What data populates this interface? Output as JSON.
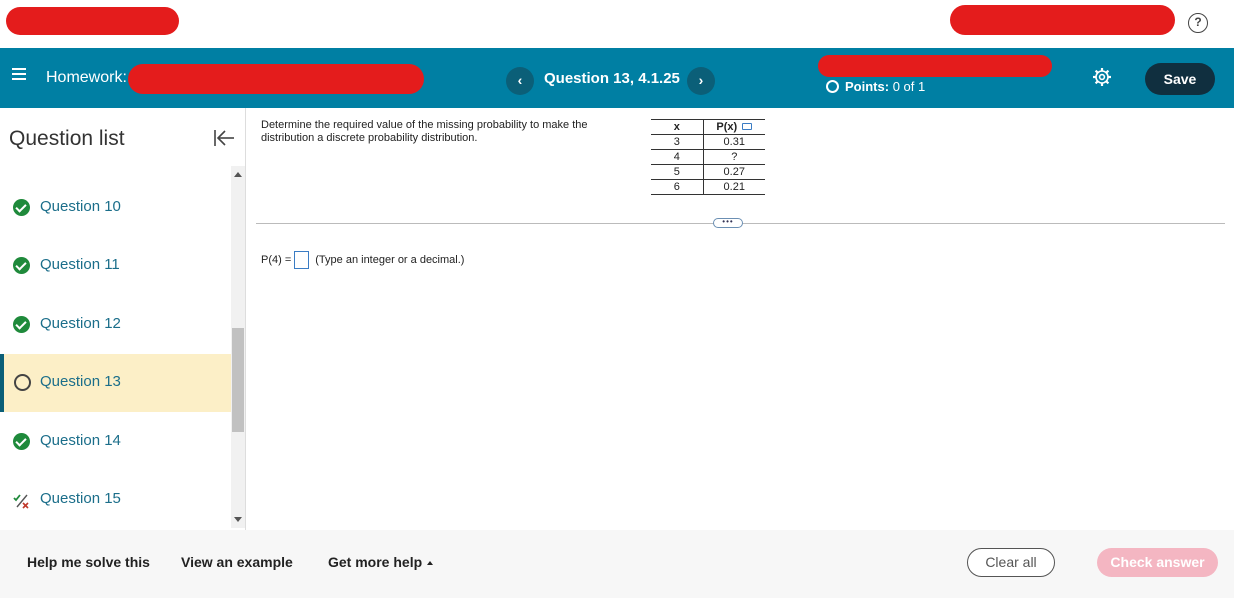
{
  "header": {
    "homework_label": "Homework:",
    "question_title": "Question 13, 4.1.25",
    "prev_symbol": "‹",
    "next_symbol": "›",
    "points_label": "Points:",
    "points_value": "0 of 1",
    "save_label": "Save",
    "colors": {
      "header_bg": "#007fa3",
      "save_bg": "#102f3f"
    }
  },
  "help_symbol": "?",
  "sidebar": {
    "title": "Question list",
    "items": [
      {
        "label": "Question 10",
        "status": "correct"
      },
      {
        "label": "Question 11",
        "status": "correct"
      },
      {
        "label": "Question 12",
        "status": "correct"
      },
      {
        "label": "Question 13",
        "status": "current"
      },
      {
        "label": "Question 14",
        "status": "correct"
      },
      {
        "label": "Question 15",
        "status": "partial"
      }
    ]
  },
  "question": {
    "prompt": "Determine the required value of the missing probability to make the distribution a discrete probability distribution.",
    "table": {
      "headers": [
        "x",
        "P(x)"
      ],
      "rows": [
        [
          "3",
          "0.31"
        ],
        [
          "4",
          "?"
        ],
        [
          "5",
          "0.27"
        ],
        [
          "6",
          "0.21"
        ]
      ]
    },
    "more_symbol": "•••",
    "answer_label": "P(4) =",
    "answer_value": "",
    "answer_hint": "(Type an integer or a decimal.)"
  },
  "footer": {
    "help_solve": "Help me solve this",
    "view_example": "View an example",
    "more_help": "Get more help",
    "clear_all": "Clear all",
    "check_answer": "Check answer"
  }
}
